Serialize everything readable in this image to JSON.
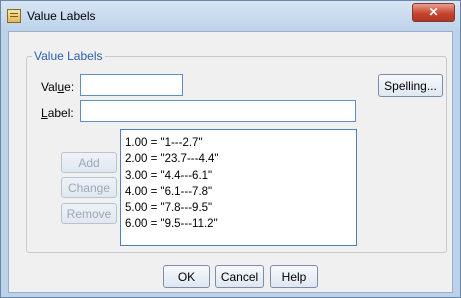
{
  "window": {
    "title": "Value Labels",
    "close_glyph": "✕"
  },
  "group": {
    "label": "Value Labels"
  },
  "fields": {
    "value_label_pre": "Val",
    "value_label_key": "u",
    "value_label_post": "e:",
    "value": "",
    "label_label_key": "L",
    "label_label_post": "abel:",
    "label": ""
  },
  "buttons": {
    "spelling": "Spelling...",
    "add": "Add",
    "change": "Change",
    "remove": "Remove",
    "ok": "OK",
    "cancel": "Cancel",
    "help": "Help"
  },
  "list": {
    "items": [
      "1.00 = \"1---2.7\"",
      "2.00 = \"23.7---4.4\"",
      "3.00 = \"4.4---6.1\"",
      "4.00 = \"6.1---7.8\"",
      "5.00 = \"7.8---9.5\"",
      "6.00 = \"9.5---11.2\""
    ]
  }
}
